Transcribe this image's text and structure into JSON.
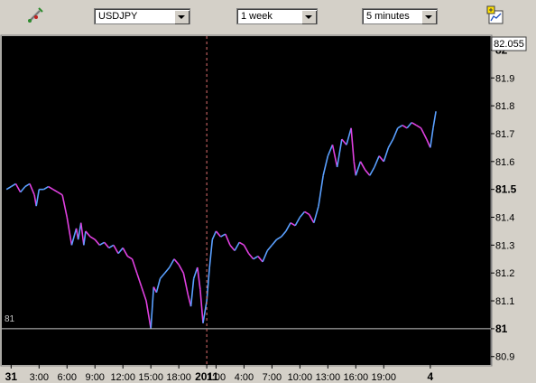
{
  "toolbar": {
    "tools_icon": "chart-tools-icon",
    "symbol": "USDJPY",
    "range": "1 week",
    "interval": "5 minutes",
    "chart_settings_icon": "chart-settings-icon"
  },
  "chart_data": {
    "type": "line",
    "title": "",
    "current_price": "82.055",
    "reference_line": {
      "value": 81,
      "label": "81"
    },
    "ylim": [
      80.87,
      82.05
    ],
    "y_ticks": [
      {
        "label": "82",
        "value": 82.0,
        "bold": true
      },
      {
        "label": "81.9",
        "value": 81.9,
        "bold": false
      },
      {
        "label": "81.8",
        "value": 81.8,
        "bold": false
      },
      {
        "label": "81.7",
        "value": 81.7,
        "bold": false
      },
      {
        "label": "81.6",
        "value": 81.6,
        "bold": false
      },
      {
        "label": "81.5",
        "value": 81.5,
        "bold": true
      },
      {
        "label": "81.4",
        "value": 81.4,
        "bold": false
      },
      {
        "label": "81.3",
        "value": 81.3,
        "bold": false
      },
      {
        "label": "81.2",
        "value": 81.2,
        "bold": false
      },
      {
        "label": "81.1",
        "value": 81.1,
        "bold": false
      },
      {
        "label": "81",
        "value": 81.0,
        "bold": true
      },
      {
        "label": "80.9",
        "value": 80.9,
        "bold": false
      }
    ],
    "xlim": [
      0,
      52.5
    ],
    "x_ticks": [
      {
        "label": "31",
        "value": 1,
        "bold": true
      },
      {
        "label": "3:00",
        "value": 4,
        "bold": false
      },
      {
        "label": "6:00",
        "value": 7,
        "bold": false
      },
      {
        "label": "9:00",
        "value": 10,
        "bold": false
      },
      {
        "label": "12:00",
        "value": 13,
        "bold": false
      },
      {
        "label": "15:00",
        "value": 16,
        "bold": false
      },
      {
        "label": "18:00",
        "value": 19,
        "bold": false
      },
      {
        "label": "2011",
        "value": 22,
        "bold": true
      },
      {
        "label": "1:00",
        "value": 23,
        "bold": false
      },
      {
        "label": "4:00",
        "value": 26,
        "bold": false
      },
      {
        "label": "7:00",
        "value": 29,
        "bold": false
      },
      {
        "label": "10:00",
        "value": 32,
        "bold": false
      },
      {
        "label": "13:00",
        "value": 35,
        "bold": false
      },
      {
        "label": "16:00",
        "value": 38,
        "bold": false
      },
      {
        "label": "19:00",
        "value": 41,
        "bold": false
      },
      {
        "label": "4",
        "value": 46,
        "bold": true
      }
    ],
    "day_divider": 22,
    "series": [
      {
        "x": [
          0.5,
          1,
          1.5,
          2,
          2.5,
          3,
          3.5,
          3.7,
          4,
          4.5,
          5,
          5.5,
          6,
          6.5,
          7,
          7.5,
          8,
          8.2,
          8.5,
          8.8,
          9,
          9.5,
          10,
          10.5,
          11,
          11.5,
          12,
          12.5,
          13,
          13.5,
          14,
          14.5,
          15,
          15.5,
          16,
          16.3,
          16.6,
          17,
          17.5,
          18,
          18.5,
          19,
          19.5,
          20,
          20.3,
          20.6,
          21,
          21.3,
          21.6,
          22,
          22.3,
          22.6,
          23,
          23.5,
          24,
          24.5,
          25,
          25.5,
          26,
          26.5,
          27,
          27.5,
          28,
          28.5,
          29,
          29.5,
          30,
          30.5,
          31,
          31.5,
          32,
          32.5,
          33,
          33.5,
          34,
          34.5,
          35,
          35.5,
          36,
          36.5,
          37,
          37.5,
          37.8,
          38,
          38.5,
          39,
          39.5,
          40,
          40.5,
          41,
          41.5,
          42,
          42.5,
          43,
          43.5,
          44,
          44.5,
          45,
          45.3,
          45.6,
          46,
          46.3,
          46.6
        ],
        "y": [
          81.5,
          81.51,
          81.52,
          81.49,
          81.51,
          81.52,
          81.48,
          81.44,
          81.5,
          81.5,
          81.51,
          81.5,
          81.49,
          81.48,
          81.4,
          81.3,
          81.36,
          81.32,
          81.38,
          81.3,
          81.35,
          81.33,
          81.32,
          81.3,
          81.31,
          81.29,
          81.3,
          81.27,
          81.29,
          81.26,
          81.25,
          81.2,
          81.15,
          81.1,
          81.0,
          81.15,
          81.13,
          81.18,
          81.2,
          81.22,
          81.25,
          81.23,
          81.2,
          81.12,
          81.08,
          81.18,
          81.22,
          81.14,
          81.02,
          81.1,
          81.22,
          81.32,
          81.35,
          81.33,
          81.34,
          81.3,
          81.28,
          81.31,
          81.3,
          81.27,
          81.25,
          81.26,
          81.24,
          81.28,
          81.3,
          81.32,
          81.33,
          81.35,
          81.38,
          81.37,
          81.4,
          81.42,
          81.41,
          81.38,
          81.44,
          81.55,
          81.62,
          81.66,
          81.58,
          81.68,
          81.66,
          81.72,
          81.6,
          81.55,
          81.6,
          81.57,
          81.55,
          81.58,
          81.62,
          81.6,
          81.65,
          81.68,
          81.72,
          81.73,
          81.72,
          81.74,
          81.73,
          81.72,
          81.7,
          81.68,
          81.65,
          81.72,
          81.78
        ]
      }
    ]
  }
}
